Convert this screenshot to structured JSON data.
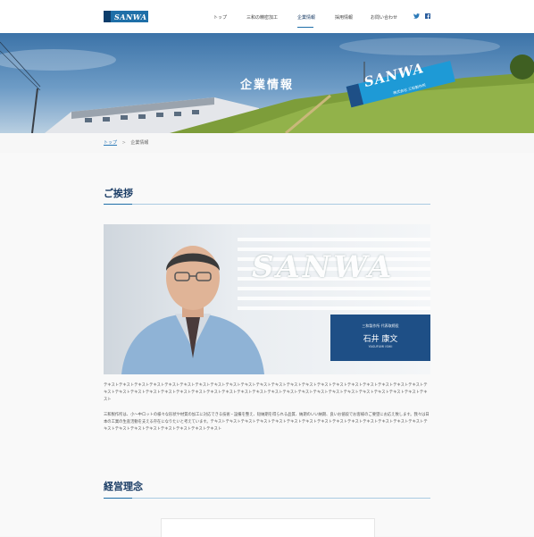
{
  "header": {
    "logo_text": "SANWA",
    "nav": [
      "トップ",
      "三和の精密加工",
      "企業情報",
      "採用情報",
      "お問い合わせ"
    ],
    "active_nav": "企業情報",
    "social": [
      "twitter-icon",
      "facebook-icon"
    ]
  },
  "hero": {
    "title": "企業情報",
    "sign_text": "SANWA",
    "sign_sub": "株式会社 三和製作所"
  },
  "breadcrumb": {
    "home": "トップ",
    "separator": ">",
    "current": "企業情報"
  },
  "greeting": {
    "heading": "ご挨拶",
    "photo_sign": "SANWA",
    "role": "三和製作所 代表取締役",
    "name": "石井 康文",
    "name_en": "YASUFUMI ISHII",
    "para1": "テキストテキストテキストテキストテキストテキストテキストテキストテキストテキストテキストテキストテキストテキストテキストテキストテキストテキストテキストテキストテキストテキストテキストテキストテキストテキストテキストテキストテキストテキストテキストテキストテキストテキストテキストテキストテキストテキストテキストテキストテキストテキストテキスト",
    "para2": "三和製作所は、小～中ロットの様々な形状や材質の加工に対応できる技術・設備を整え、短納期を得られる品質、納期のいい納期、良いお値段でお客様のご要望にお応え致します。我々は日本の工業の生産活動を支える存在になりたいと考えています。テキストテキストテキストテキストテキストテキストテキストテキストテキストテキストテキストテキストテキストテキストテキストテキストテキストテキストテキストテキストテキストテキスト"
  },
  "philosophy": {
    "heading": "経営理念"
  },
  "colors": {
    "accent": "#1f6fa8",
    "navy": "#1e4f86",
    "heading": "#1b3d66"
  }
}
